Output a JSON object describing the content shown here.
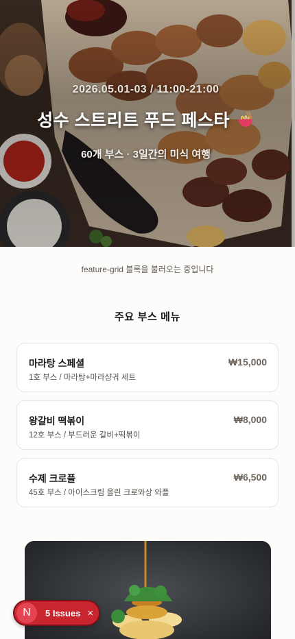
{
  "hero": {
    "date": "2026.05.01-03 / 11:00-21:00",
    "title": "성수 스트리트 푸드 페스타",
    "title_icon": "ramen-bowl-icon",
    "subtitle": "60개 부스 · 3일간의 미식 여행"
  },
  "loading_note": "feature-grid 블록을 불러오는 중입니다",
  "menu": {
    "title": "주요 부스 메뉴",
    "items": [
      {
        "name": "마라탕 스페셜",
        "desc": "1호 부스 / 마라탕+마라샹궈 세트",
        "price": "₩15,000"
      },
      {
        "name": "왕갈비 떡볶이",
        "desc": "12호 부스 / 부드러운 갈비+떡볶이",
        "price": "₩8,000"
      },
      {
        "name": "수제 크로플",
        "desc": "45호 부스 / 아이스크림 올린 크로와상 와플",
        "price": "₩6,500"
      }
    ]
  },
  "issues": {
    "logo": "N",
    "label": "5 Issues",
    "close": "×"
  }
}
